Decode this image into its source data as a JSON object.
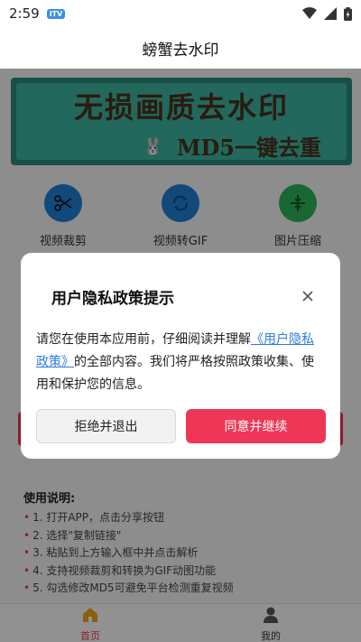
{
  "status_bar": {
    "time": "2:59",
    "badge": "ITV"
  },
  "app": {
    "title": "螃蟹去水印"
  },
  "banner": {
    "line1": "无损画质去水印",
    "line2": "MD5一键去重"
  },
  "tools": [
    {
      "label": "视频裁剪",
      "icon": "scissors-icon",
      "color": "#1e7fd4"
    },
    {
      "label": "视频转GIF",
      "icon": "convert-icon",
      "color": "#1e7fd4"
    },
    {
      "label": "图片压缩",
      "icon": "compress-icon",
      "color": "#2bb35a"
    }
  ],
  "instructions": {
    "title": "使用说明:",
    "items": [
      "1. 打开APP，点击分享按钮",
      "2. 选择\"复制链接\"",
      "3. 粘贴到上方输入框中并点击解析",
      "4. 支持视频裁剪和转换为GIF动图功能",
      "5. 勾选修改MD5可避免平台检测重复视频"
    ]
  },
  "nav": {
    "home": "首页",
    "mine": "我的",
    "active_color": "#e8354f"
  },
  "dialog": {
    "title": "用户隐私政策提示",
    "body_before": "请您在使用本应用前，仔细阅读并理解",
    "body_link": "《用户隐私政策》",
    "body_after": "的全部内容。我们将严格按照政策收集、使用和保护您的信息。",
    "reject_label": "拒绝并退出",
    "agree_label": "同意并继续",
    "agree_color": "#ee3756"
  }
}
